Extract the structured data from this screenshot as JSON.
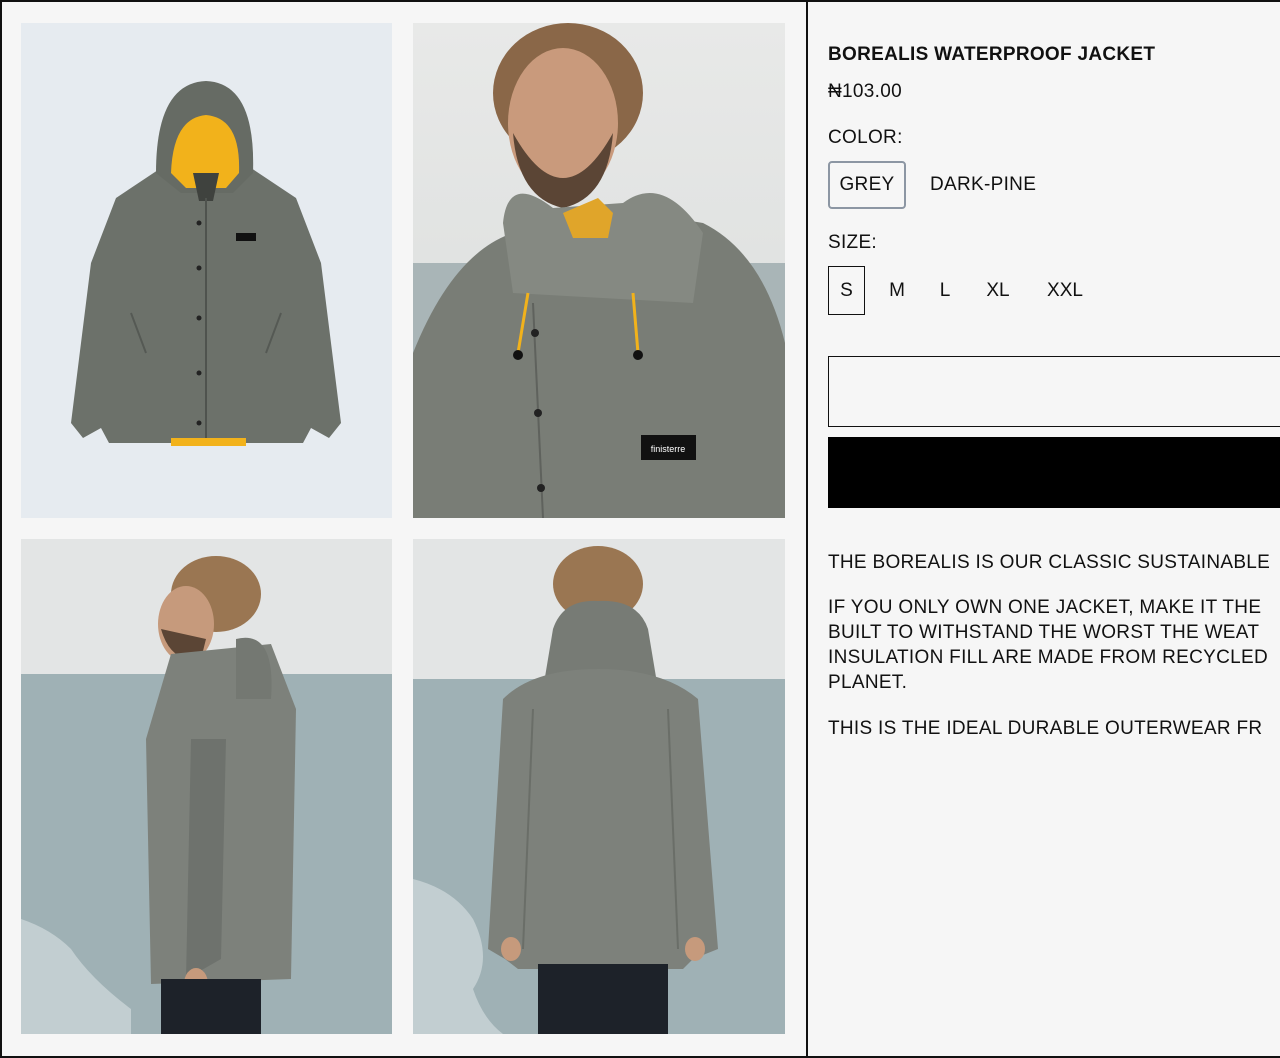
{
  "product": {
    "title": "BOREALIS WATERPROOF JACKET",
    "price": "₦103.00",
    "color_label": "COLOR:",
    "colors": [
      "GREY",
      "DARK-PINE"
    ],
    "selected_color": "GREY",
    "size_label": "SIZE:",
    "sizes": [
      "S",
      "M",
      "L",
      "XL",
      "XXL"
    ],
    "selected_size": "S",
    "description": [
      "THE BOREALIS IS OUR CLASSIC SUSTAINABLE",
      "IF YOU ONLY OWN ONE JACKET, MAKE IT THE",
      "BUILT TO WITHSTAND THE WORST THE WEAT",
      "INSULATION FILL ARE MADE FROM RECYCLED",
      "PLANET.",
      "THIS IS THE IDEAL DURABLE OUTERWEAR FR"
    ]
  },
  "gallery": {
    "images": [
      "jacket-flat-lay",
      "model-front-portrait",
      "model-side-view",
      "model-back-view"
    ],
    "logo_text": "finisterre"
  },
  "colors": {
    "background": "#f6f6f6",
    "jacket": "#6c716a",
    "lining": "#f2b21b",
    "sea": "#9fb1b5",
    "sky": "#e3e5e5",
    "selected_border": "#8c96a3",
    "button_primary": "#000000"
  }
}
